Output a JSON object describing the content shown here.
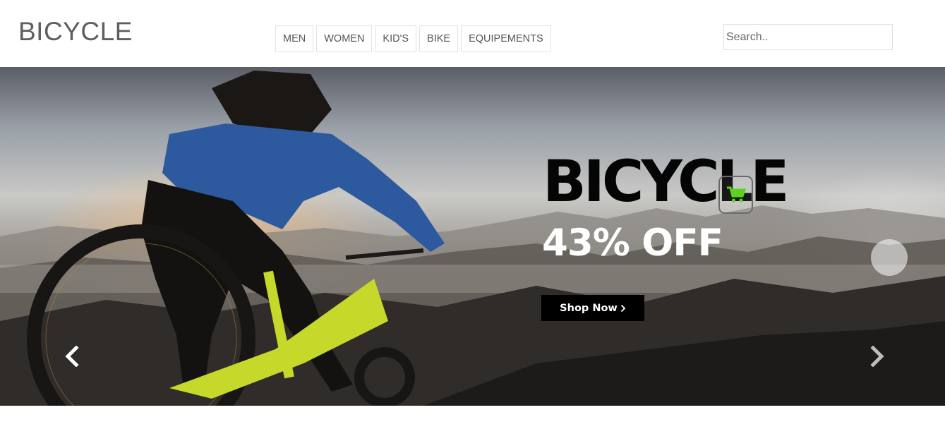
{
  "header": {
    "logo": "BICYCLE",
    "nav": [
      "MEN",
      "WOMEN",
      "KID'S",
      "BIKE",
      "EQUIPEMENTS"
    ],
    "search_placeholder": "Search.."
  },
  "hero": {
    "headline": "BICYCLE",
    "subheadline": "43% OFF",
    "cta_label": "Shop Now",
    "cta_icon": "chevron-right-icon",
    "cart_icon": "shopping-cart-icon",
    "cart_color": "#5ad21e",
    "prev_icon": "chevron-left-icon",
    "next_icon": "chevron-right-icon",
    "image": "mountain-biker-at-sunset"
  }
}
